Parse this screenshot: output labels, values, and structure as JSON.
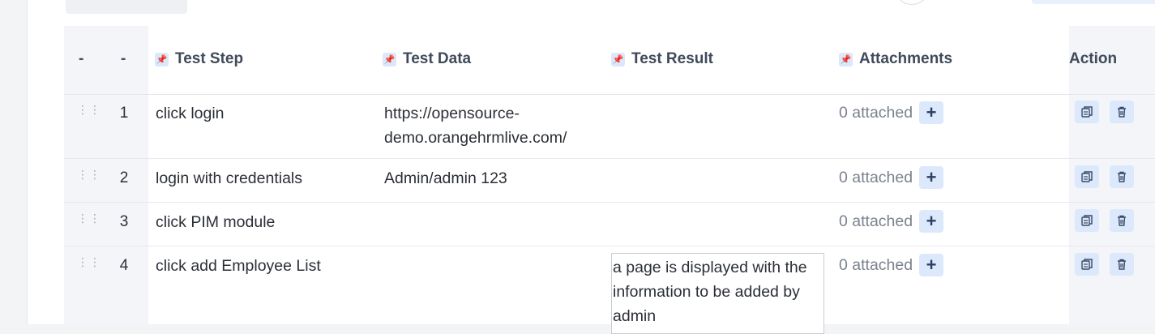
{
  "header": {
    "col_dash_1": "-",
    "col_dash_2": "-",
    "test_step": "Test Step",
    "test_data": "Test Data",
    "test_result": "Test Result",
    "attachments": "Attachments",
    "action": "Action",
    "pin_glyph": "📌"
  },
  "rows": [
    {
      "num": "1",
      "step": "click login",
      "data_line1": "https://opensource-",
      "data_line2": "demo.orangehrmlive.com/",
      "result": "",
      "attached": "0 attached"
    },
    {
      "num": "2",
      "step": "login with credentials",
      "data_line1": "Admin/admin 123",
      "data_line2": "",
      "result": "",
      "attached": "0 attached"
    },
    {
      "num": "3",
      "step": "click PIM module",
      "data_line1": "",
      "data_line2": "",
      "result": "",
      "attached": "0 attached"
    },
    {
      "num": "4",
      "step": "click add Employee List",
      "data_line1": "",
      "data_line2": "",
      "result": "a page is displayed with the information to be added by admin",
      "attached": "0 attached"
    }
  ],
  "plus_glyph": "+",
  "grip_glyph": "⋮⋮",
  "icons": {
    "drag": "drag-handle-icon",
    "copy": "copy-icon",
    "delete": "trash-icon",
    "pin": "pin-icon",
    "add": "plus-icon"
  },
  "colors": {
    "accent_bg": "#dce8fb",
    "pinned_col_bg": "#f3f5f8",
    "header_text": "#3f4a5a",
    "muted_text": "#7a828d"
  }
}
